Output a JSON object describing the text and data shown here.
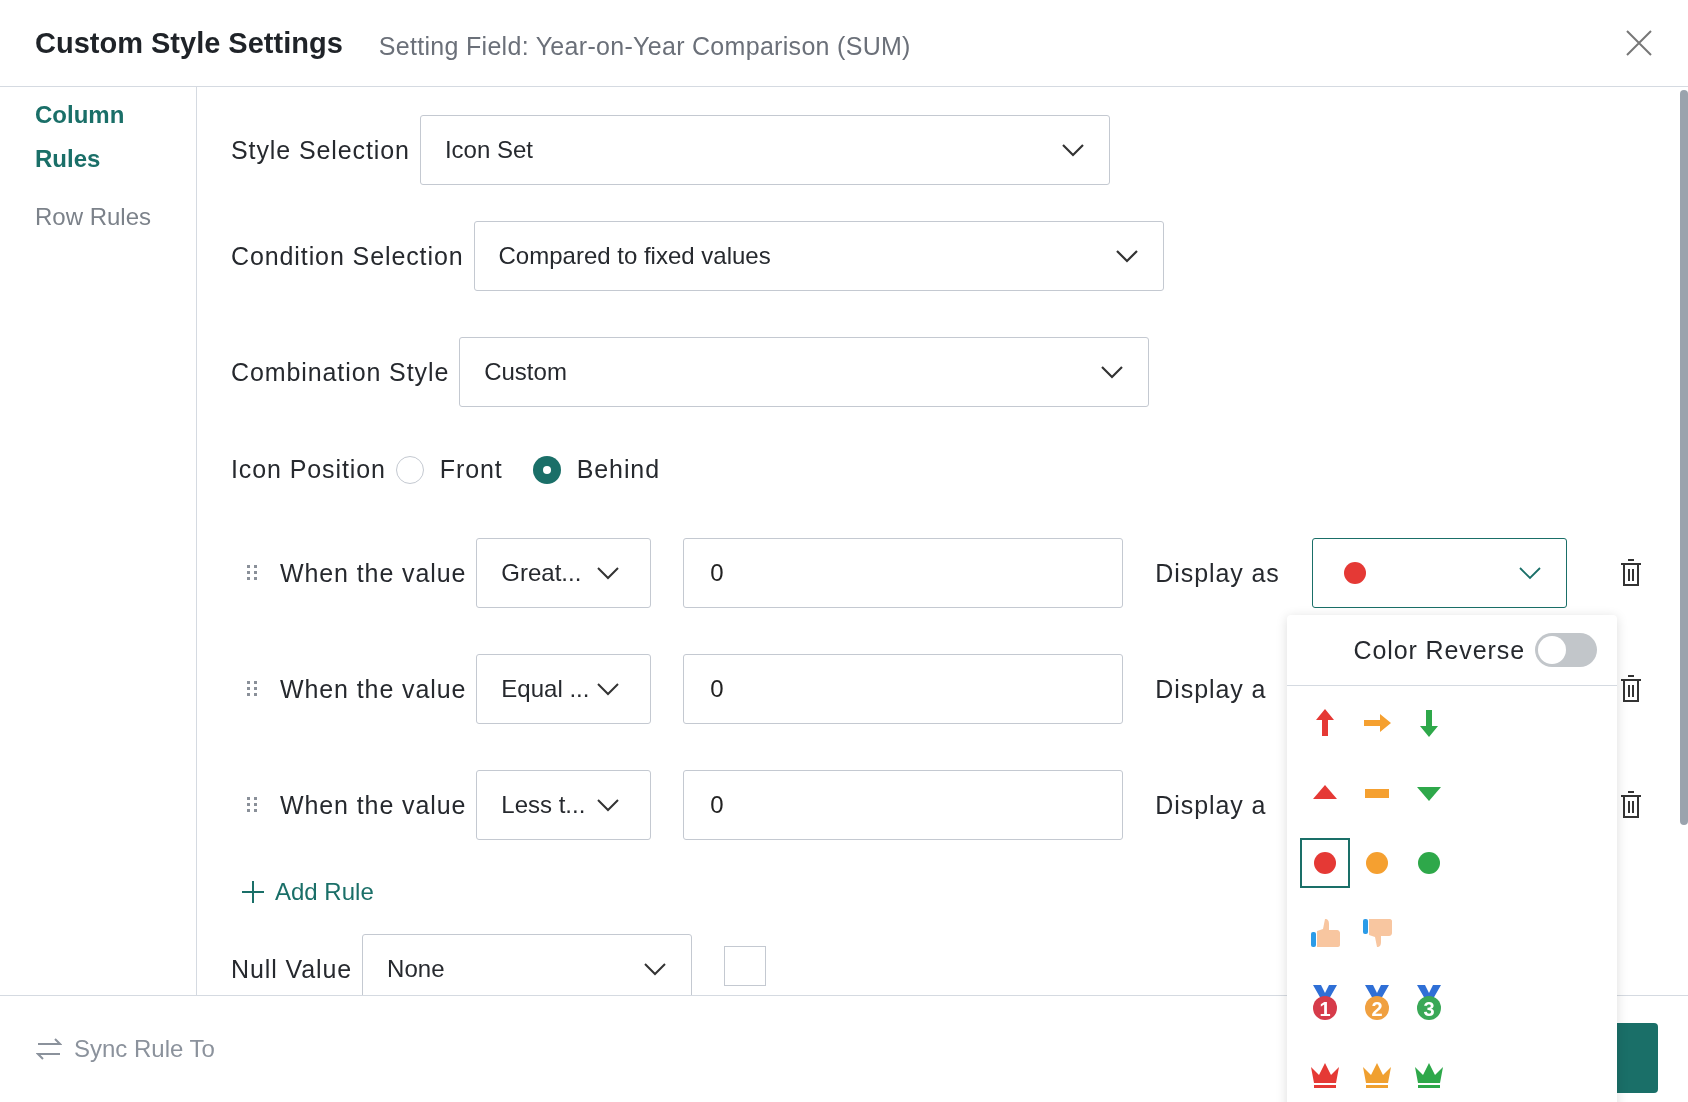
{
  "dialog": {
    "title": "Custom Style Settings",
    "subtitle": "Setting Field: Year-on-Year Comparison (SUM)"
  },
  "sidebar": {
    "items": [
      {
        "label": "Column Rules",
        "selected": true
      },
      {
        "label": "Row Rules",
        "selected": false
      }
    ]
  },
  "fields": [
    {
      "label": "Style Selection",
      "value": "Icon Set"
    },
    {
      "label": "Condition Selection",
      "value": "Compared to fixed values"
    },
    {
      "label": "Combination Style",
      "value": "Custom"
    }
  ],
  "icon_position": {
    "label": "Icon Position",
    "options": [
      {
        "label": "Front",
        "selected": false
      },
      {
        "label": "Behind",
        "selected": true
      }
    ]
  },
  "rules": [
    {
      "prefix": "When the value",
      "operator": "Great...",
      "value": "0",
      "display_label": "Display as",
      "display_icon": {
        "kind": "circle",
        "color": "#e53935"
      }
    },
    {
      "prefix": "When the value",
      "operator": "Equal ...",
      "value": "0",
      "display_label": "Display a"
    },
    {
      "prefix": "When the value",
      "operator": "Less t...",
      "value": "0",
      "display_label": "Display a"
    }
  ],
  "add_rule": "Add Rule",
  "null_value": {
    "label": "Null Value",
    "value": "None"
  },
  "footer": {
    "sync": "Sync Rule To"
  },
  "popup": {
    "toggle": {
      "label": "Color Reverse",
      "on": false
    },
    "icon_rows": [
      {
        "options": [
          {
            "kind": "arrow-up",
            "color": "#e53935",
            "selected": false
          },
          {
            "kind": "arrow-right",
            "color": "#f5a030",
            "selected": false
          },
          {
            "kind": "arrow-down",
            "color": "#2ea84a",
            "selected": false
          }
        ]
      },
      {
        "options": [
          {
            "kind": "triangle-up",
            "color": "#e53935",
            "selected": false
          },
          {
            "kind": "dash",
            "color": "#f5a030",
            "selected": false
          },
          {
            "kind": "triangle-down",
            "color": "#2ea84a",
            "selected": false
          }
        ]
      },
      {
        "options": [
          {
            "kind": "circle",
            "color": "#e53935",
            "selected": true
          },
          {
            "kind": "circle",
            "color": "#f5a030",
            "selected": false
          },
          {
            "kind": "circle",
            "color": "#2ea84a",
            "selected": false
          }
        ]
      },
      {
        "options": [
          {
            "kind": "thumb-up",
            "selected": false
          },
          {
            "kind": "thumb-down",
            "selected": false
          }
        ]
      },
      {
        "options": [
          {
            "kind": "medal",
            "color": "#d63b4a",
            "label": "1",
            "selected": false
          },
          {
            "kind": "medal",
            "color": "#f0a040",
            "label": "2",
            "selected": false
          },
          {
            "kind": "medal",
            "color": "#3aa857",
            "label": "3",
            "selected": false
          }
        ]
      },
      {
        "options": [
          {
            "kind": "crown",
            "color": "#e53935",
            "selected": false
          },
          {
            "kind": "crown",
            "color": "#f0a030",
            "selected": false
          },
          {
            "kind": "crown",
            "color": "#2ea84a",
            "selected": false
          }
        ]
      }
    ]
  }
}
